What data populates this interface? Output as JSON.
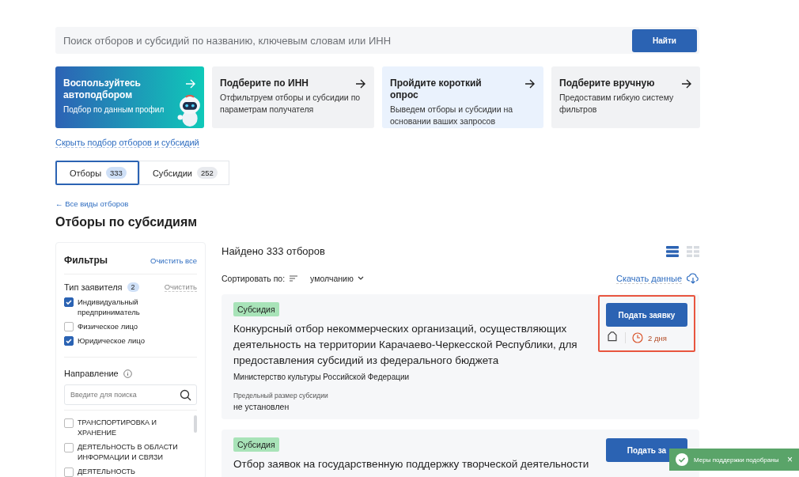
{
  "search": {
    "placeholder": "Поиск отборов и субсидий по названию, ключевым словам или ИНН",
    "button": "Найти"
  },
  "promo_cards": [
    {
      "kind": "auto",
      "title": "Воспользуйтесь автоподбором",
      "text": "Подбор по данным профил"
    },
    {
      "kind": "gray",
      "title": "Подберите по ИНН",
      "text": "Отфильтруем отборы и субсидии по параметрам получателя"
    },
    {
      "kind": "blue",
      "title": "Пройдите короткий опрос",
      "text": "Выведем отборы и субсидии на основании ваших запросов"
    },
    {
      "kind": "gray",
      "title": "Подберите вручную",
      "text": "Предоставим гибкую систему фильтров"
    }
  ],
  "hide_link": "Скрыть подбор отборов и субсидий",
  "tabs": [
    {
      "label": "Отборы",
      "count": "333",
      "selected": true
    },
    {
      "label": "Субсидии",
      "count": "252",
      "selected": false
    }
  ],
  "back_link": "← Все виды отборов",
  "page_title": "Отборы по субсидиям",
  "filters": {
    "title": "Фильтры",
    "clear_all": "Очистить все",
    "applicant": {
      "title": "Тип заявителя",
      "count": "2",
      "clear": "Очистить",
      "options": [
        {
          "label": "Индивидуальный предприниматель",
          "checked": true
        },
        {
          "label": "Физическое лицо",
          "checked": false
        },
        {
          "label": "Юридическое лицо",
          "checked": true
        }
      ]
    },
    "direction": {
      "title": "Направление",
      "placeholder": "Введите для поиска",
      "options": [
        {
          "label": "ТРАНСПОРТИРОВКА И ХРАНЕНИЕ",
          "checked": false
        },
        {
          "label": "ДЕЯТЕЛЬНОСТЬ В ОБЛАСТИ ИНФОРМАЦИИ И СВЯЗИ",
          "checked": false
        },
        {
          "label": "ДЕЯТЕЛЬНОСТЬ",
          "checked": false
        }
      ]
    }
  },
  "results": {
    "found": "Найдено 333 отборов",
    "view_modes": [
      {
        "kind": "list",
        "selected": true
      },
      {
        "kind": "grid",
        "selected": false
      }
    ],
    "sort_label": "Сортировать по:",
    "sort_value": "умолчанию",
    "download": "Скачать данные"
  },
  "cards": [
    {
      "tag": "Субсидия",
      "title": "Конкурсный отбор некоммерческих организаций, осуществляющих деятельность на территории Карачаево-Черкесской Республики, для предоставления субсидий из федерального бюджета",
      "org": "Министерство культуры Российской Федерации",
      "limit_label": "Предельный размер субсидии",
      "limit_value": "не установлен",
      "button": "Подать заявку",
      "days": "2 дня",
      "highlighted": true
    },
    {
      "tag": "Субсидия",
      "title": "Отбор заявок на государственную поддержку творческой деятельности",
      "button": "Подать за",
      "highlighted": false
    }
  ],
  "toast": {
    "text": "Меры поддержки подобраны",
    "close": "×"
  }
}
